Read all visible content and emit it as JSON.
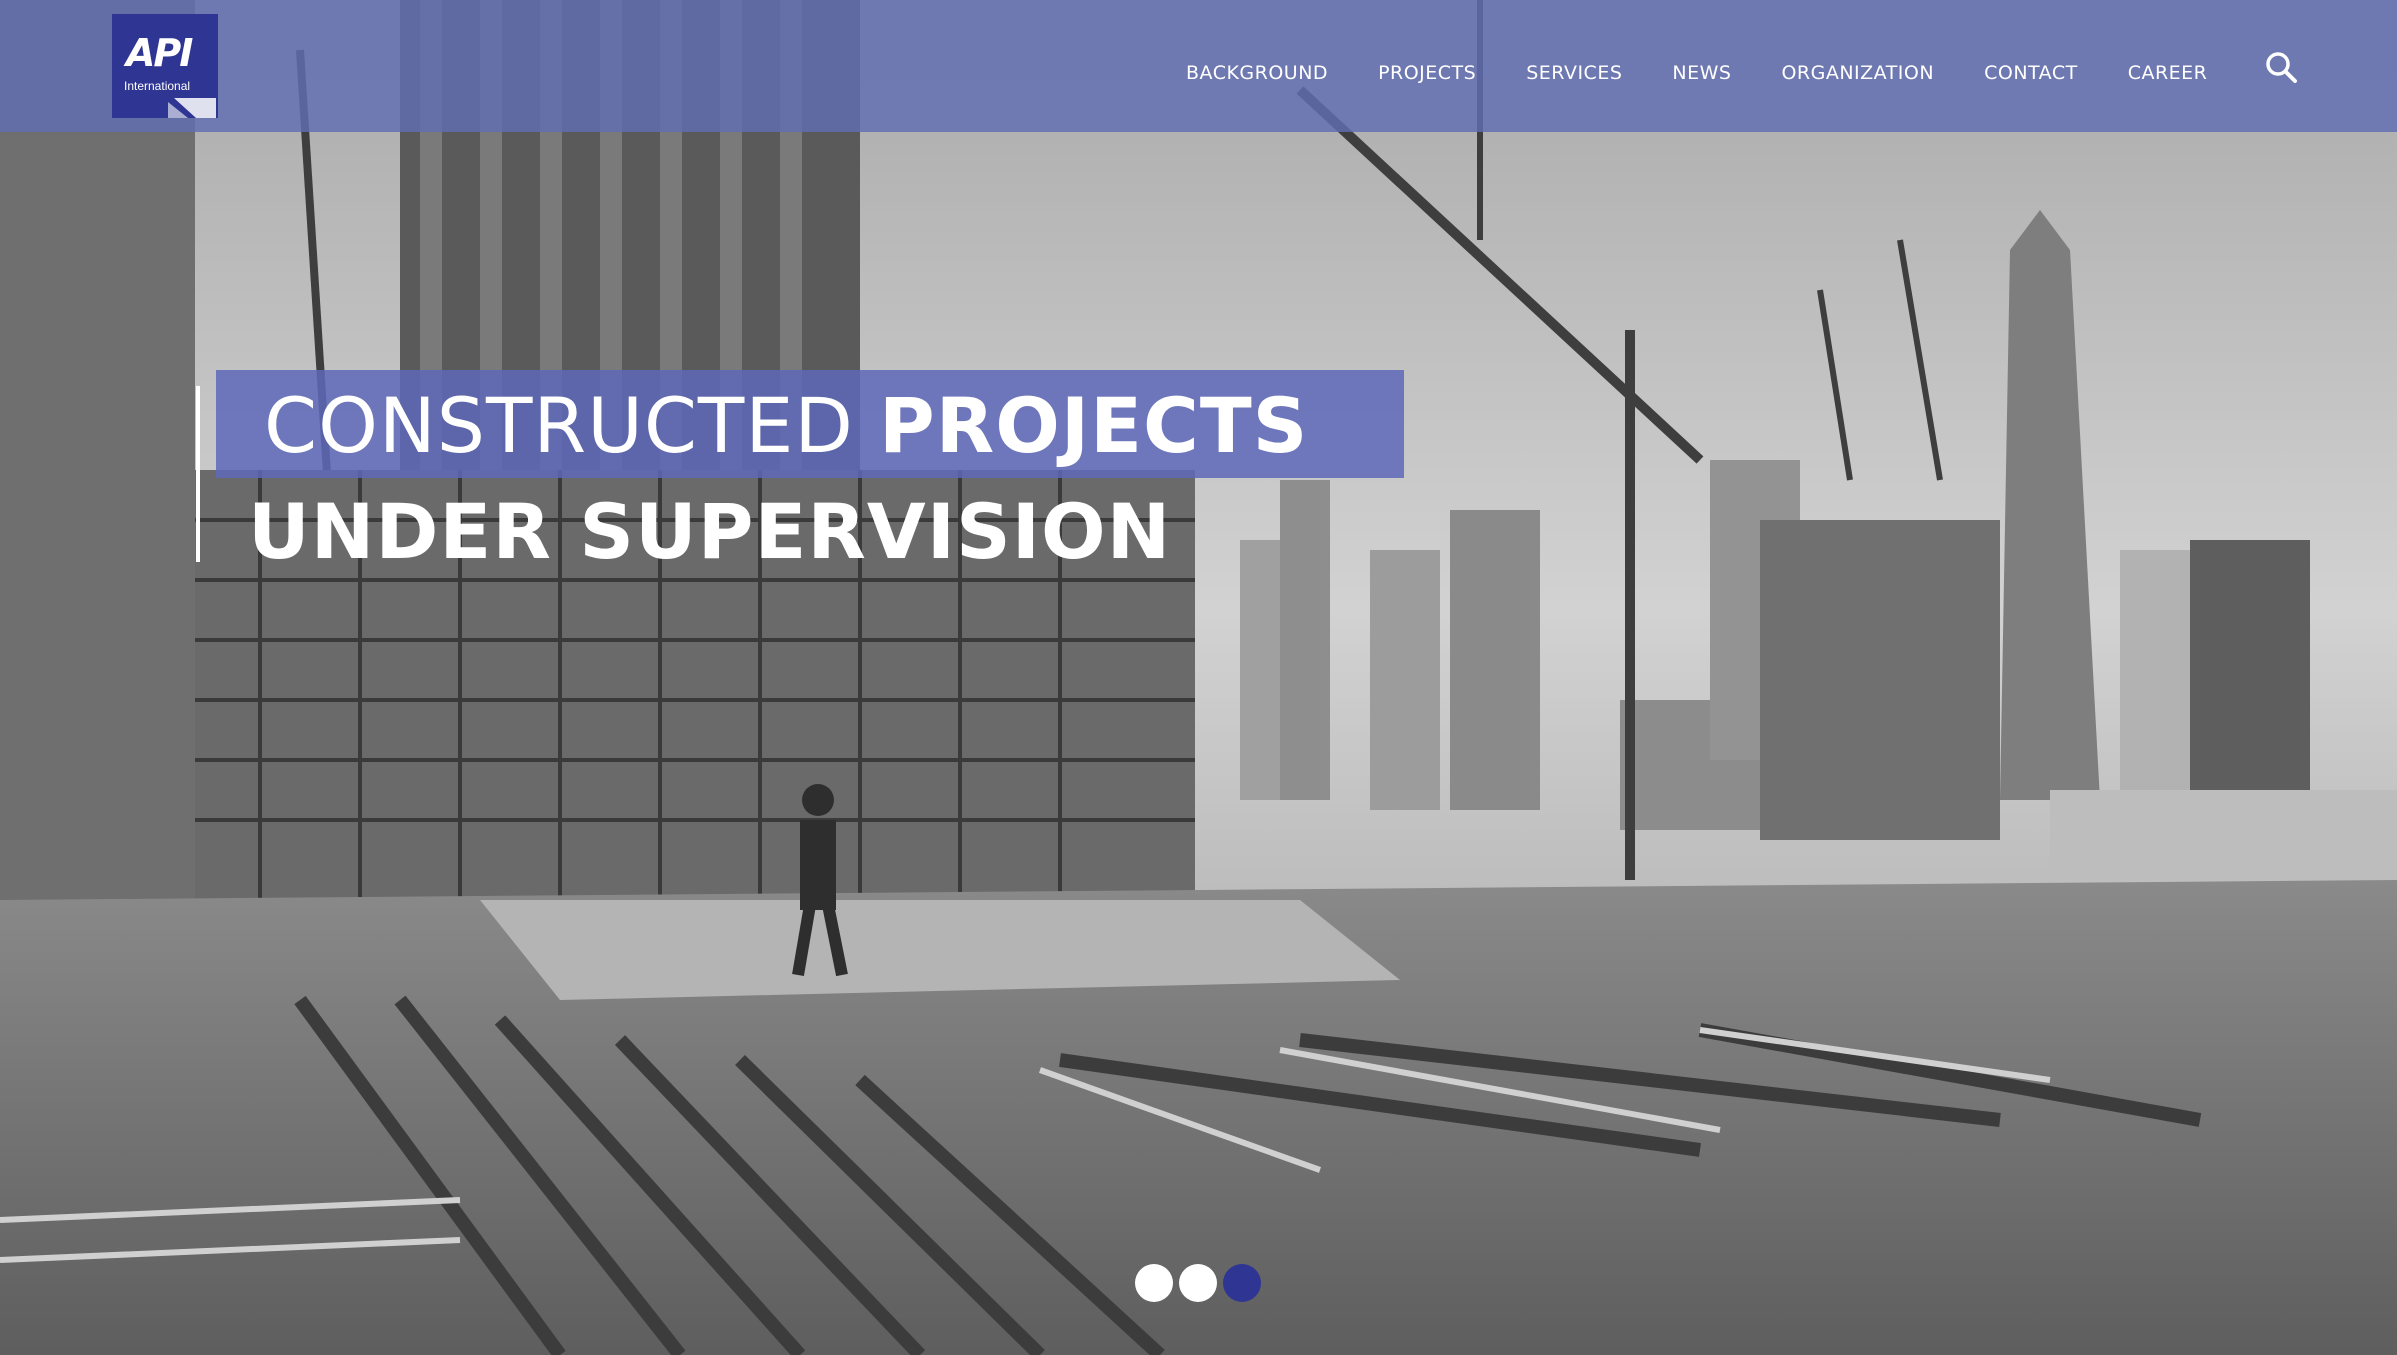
{
  "header": {
    "logo": {
      "mark": "API",
      "subtitle": "International"
    },
    "nav": [
      {
        "label": "BACKGROUND"
      },
      {
        "label": "PROJECTS"
      },
      {
        "label": "SERVICES"
      },
      {
        "label": "NEWS"
      },
      {
        "label": "ORGANIZATION"
      },
      {
        "label": "CONTACT"
      },
      {
        "label": "CAREER"
      }
    ],
    "search_icon": "search-icon"
  },
  "hero": {
    "headline_part1": "CONSTRUCTED ",
    "headline_part1_strong": "PROJECTS",
    "headline_line2": "UNDER SUPERVISION",
    "background": "grayscale photo of high-rise construction site with cranes and scaffolding",
    "slider": {
      "total_slides": 3,
      "active_slide": 3
    }
  },
  "colors": {
    "header_overlay": "#626eb2",
    "brand_navy": "#2e3592",
    "headline_box": "#5e68b8",
    "text": "#ffffff"
  }
}
